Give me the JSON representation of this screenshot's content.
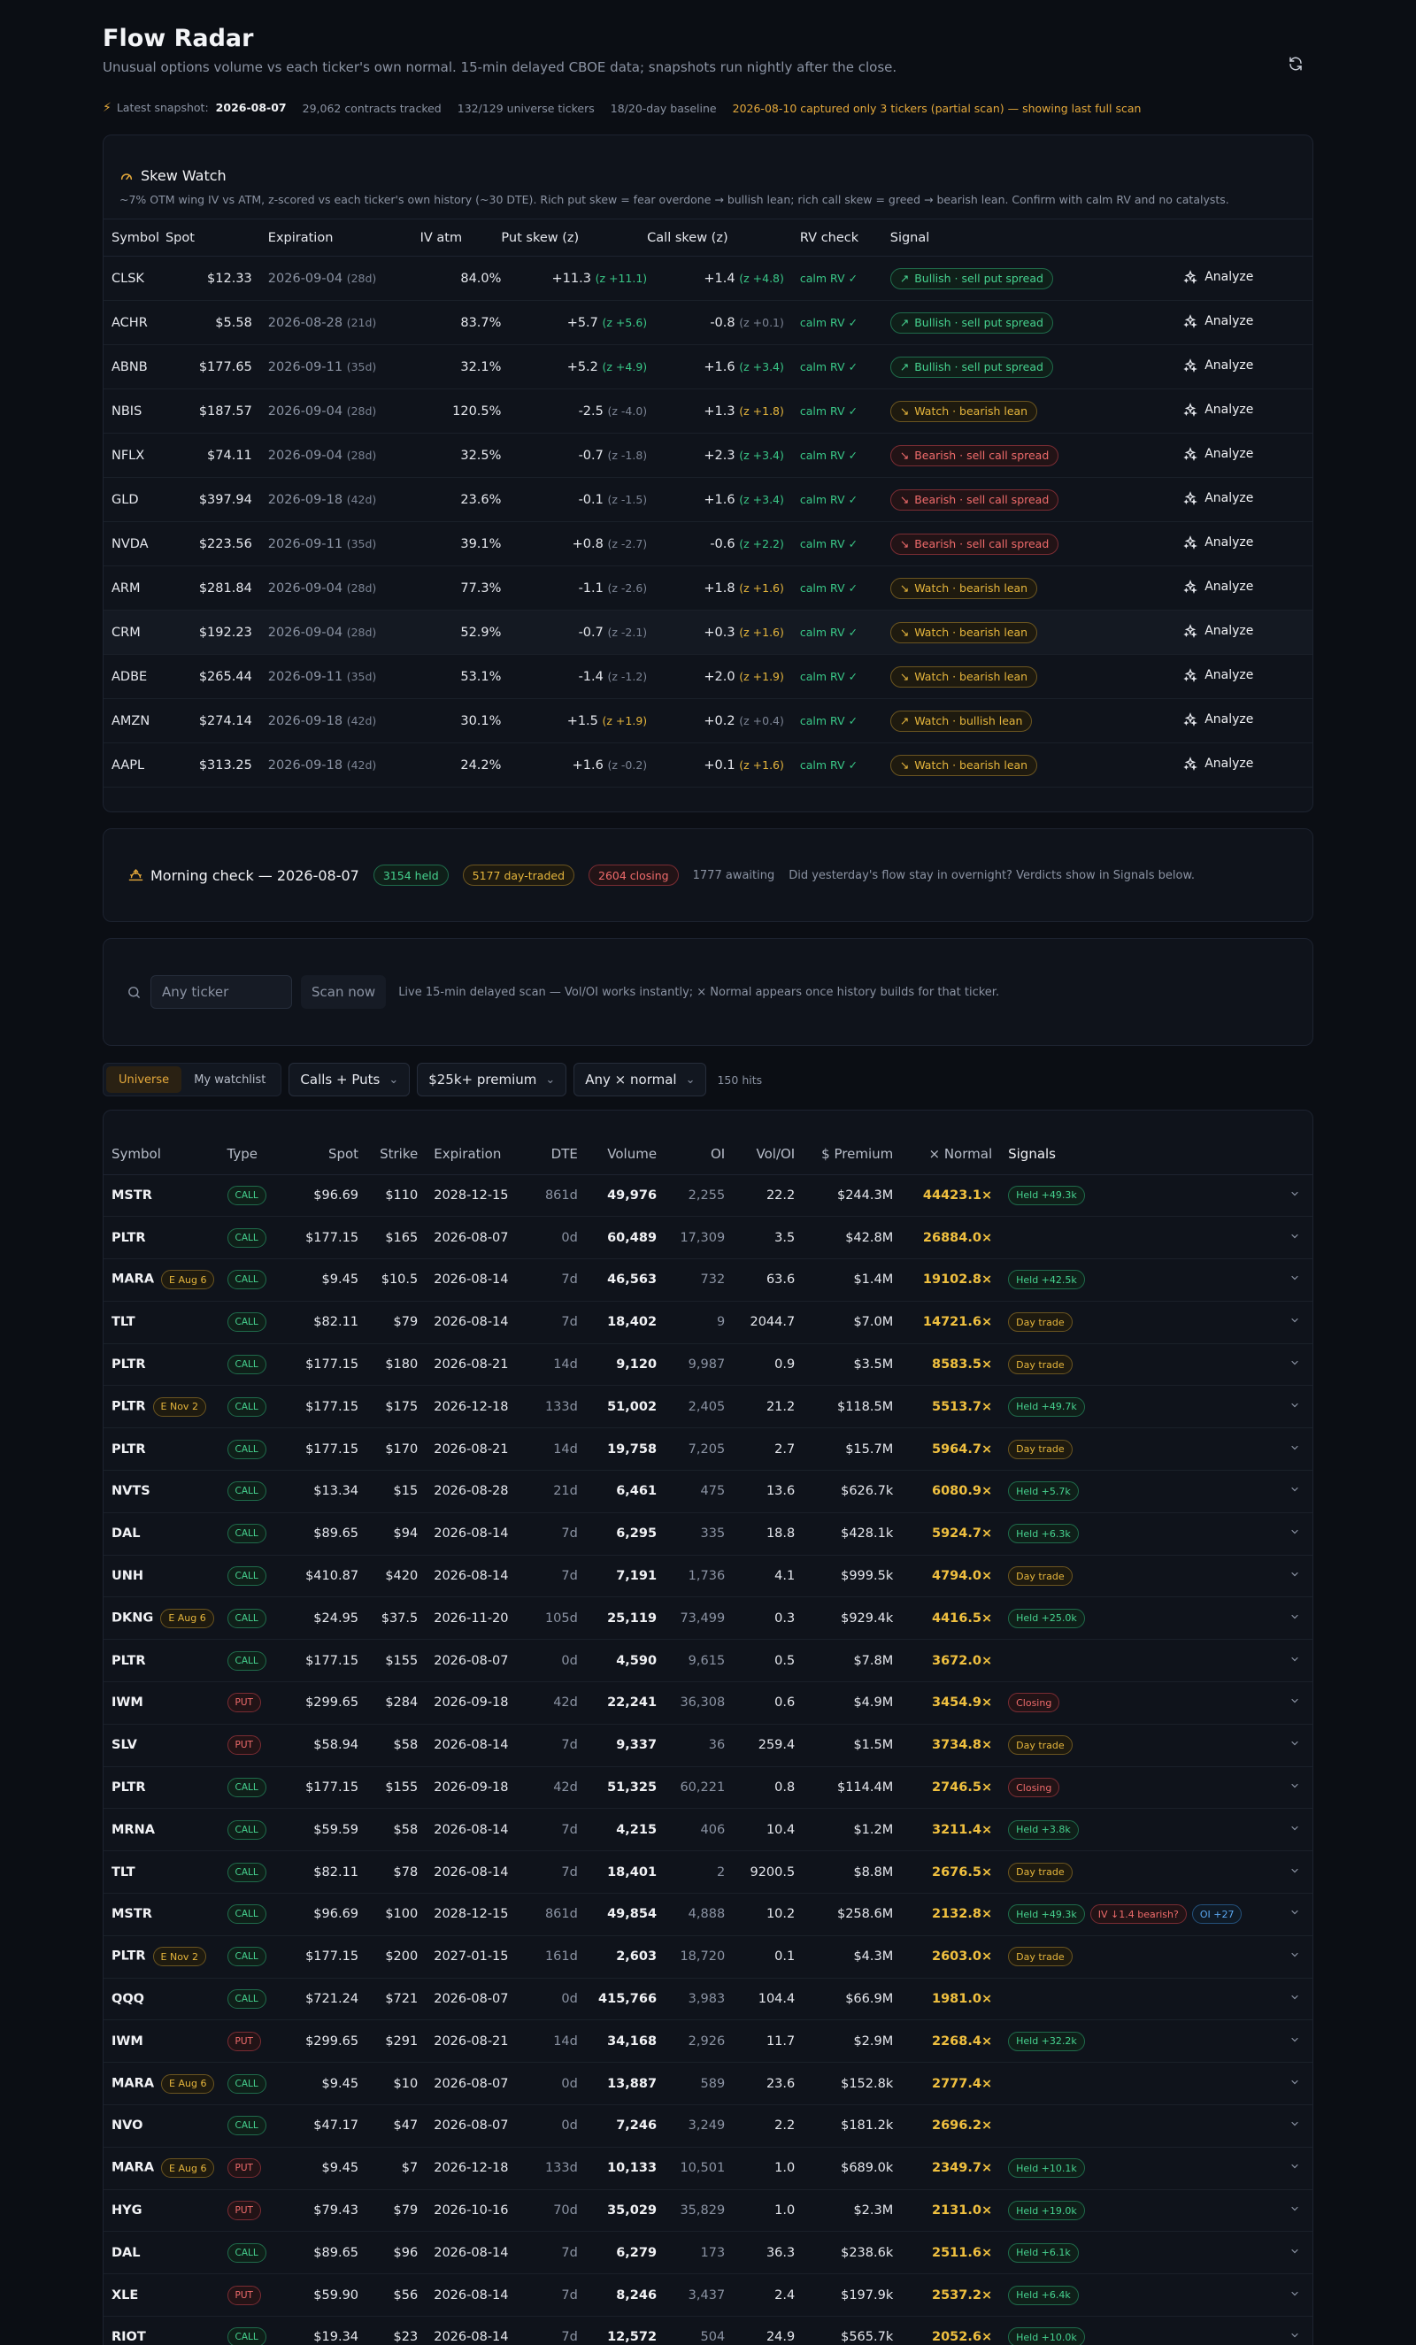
{
  "header": {
    "title": "Flow Radar",
    "subtitle": "Unusual options volume vs each ticker's own normal. 15-min delayed CBOE data; snapshots run nightly after the close."
  },
  "meta": {
    "latest_label": "Latest snapshot:",
    "latest_date": "2026-08-07",
    "contracts": "29,062 contracts tracked",
    "universe": "132/129 universe tickers",
    "baseline": "18/20-day baseline",
    "warning": "2026-08-10 captured only 3 tickers (partial scan) — showing last full scan"
  },
  "skew": {
    "title": "Skew Watch",
    "description": "~7% OTM wing IV vs ATM, z-scored vs each ticker's own history (~30 DTE). Rich put skew = fear overdone → bullish lean; rich call skew = greed → bearish lean. Confirm with calm RV and no catalysts.",
    "columns": [
      "Symbol",
      "Spot",
      "Expiration",
      "IV atm",
      "Put skew (z)",
      "Call skew (z)",
      "RV check",
      "Signal"
    ],
    "analyze_label": "Analyze",
    "rows": [
      {
        "symbol": "CLSK",
        "spot": "$12.33",
        "exp": "2026-09-04",
        "dte": "(28d)",
        "iv": "84.0%",
        "put": "+11.3",
        "put_z": "(z +11.1)",
        "put_c": "g",
        "call": "+1.4",
        "call_z": "(z +4.8)",
        "call_c": "g",
        "rv": "calm RV ✓",
        "signal": "Bullish · sell put spread",
        "sig_c": "g",
        "sig_icon": "↗"
      },
      {
        "symbol": "ACHR",
        "spot": "$5.58",
        "exp": "2026-08-28",
        "dte": "(21d)",
        "iv": "83.7%",
        "put": "+5.7",
        "put_z": "(z +5.6)",
        "put_c": "g",
        "call": "-0.8",
        "call_z": "(z +0.1)",
        "call_c": "n",
        "rv": "calm RV ✓",
        "signal": "Bullish · sell put spread",
        "sig_c": "g",
        "sig_icon": "↗"
      },
      {
        "symbol": "ABNB",
        "spot": "$177.65",
        "exp": "2026-09-11",
        "dte": "(35d)",
        "iv": "32.1%",
        "put": "+5.2",
        "put_z": "(z +4.9)",
        "put_c": "g",
        "call": "+1.6",
        "call_z": "(z +3.4)",
        "call_c": "g",
        "rv": "calm RV ✓",
        "signal": "Bullish · sell put spread",
        "sig_c": "g",
        "sig_icon": "↗"
      },
      {
        "symbol": "NBIS",
        "spot": "$187.57",
        "exp": "2026-09-04",
        "dte": "(28d)",
        "iv": "120.5%",
        "put": "-2.5",
        "put_z": "(z -4.0)",
        "put_c": "n",
        "call": "+1.3",
        "call_z": "(z +1.8)",
        "call_c": "y",
        "rv": "calm RV ✓",
        "signal": "Watch · bearish lean",
        "sig_c": "y",
        "sig_icon": "↘"
      },
      {
        "symbol": "NFLX",
        "spot": "$74.11",
        "exp": "2026-09-04",
        "dte": "(28d)",
        "iv": "32.5%",
        "put": "-0.7",
        "put_z": "(z -1.8)",
        "put_c": "n",
        "call": "+2.3",
        "call_z": "(z +3.4)",
        "call_c": "g",
        "rv": "calm RV ✓",
        "signal": "Bearish · sell call spread",
        "sig_c": "r",
        "sig_icon": "↘"
      },
      {
        "symbol": "GLD",
        "spot": "$397.94",
        "exp": "2026-09-18",
        "dte": "(42d)",
        "iv": "23.6%",
        "put": "-0.1",
        "put_z": "(z -1.5)",
        "put_c": "n",
        "call": "+1.6",
        "call_z": "(z +3.4)",
        "call_c": "g",
        "rv": "calm RV ✓",
        "signal": "Bearish · sell call spread",
        "sig_c": "r",
        "sig_icon": "↘"
      },
      {
        "symbol": "NVDA",
        "spot": "$223.56",
        "exp": "2026-09-11",
        "dte": "(35d)",
        "iv": "39.1%",
        "put": "+0.8",
        "put_z": "(z -2.7)",
        "put_c": "n",
        "call": "-0.6",
        "call_z": "(z +2.2)",
        "call_c": "g",
        "rv": "calm RV ✓",
        "signal": "Bearish · sell call spread",
        "sig_c": "r",
        "sig_icon": "↘"
      },
      {
        "symbol": "ARM",
        "spot": "$281.84",
        "exp": "2026-09-04",
        "dte": "(28d)",
        "iv": "77.3%",
        "put": "-1.1",
        "put_z": "(z -2.6)",
        "put_c": "n",
        "call": "+1.8",
        "call_z": "(z +1.6)",
        "call_c": "y",
        "rv": "calm RV ✓",
        "signal": "Watch · bearish lean",
        "sig_c": "y",
        "sig_icon": "↘"
      },
      {
        "symbol": "CRM",
        "spot": "$192.23",
        "exp": "2026-09-04",
        "dte": "(28d)",
        "iv": "52.9%",
        "put": "-0.7",
        "put_z": "(z -2.1)",
        "put_c": "n",
        "call": "+0.3",
        "call_z": "(z +1.6)",
        "call_c": "y",
        "rv": "calm RV ✓",
        "signal": "Watch · bearish lean",
        "sig_c": "y",
        "sig_icon": "↘"
      },
      {
        "symbol": "ADBE",
        "spot": "$265.44",
        "exp": "2026-09-11",
        "dte": "(35d)",
        "iv": "53.1%",
        "put": "-1.4",
        "put_z": "(z -1.2)",
        "put_c": "n",
        "call": "+2.0",
        "call_z": "(z +1.9)",
        "call_c": "y",
        "rv": "calm RV ✓",
        "signal": "Watch · bearish lean",
        "sig_c": "y",
        "sig_icon": "↘"
      },
      {
        "symbol": "AMZN",
        "spot": "$274.14",
        "exp": "2026-09-18",
        "dte": "(42d)",
        "iv": "30.1%",
        "put": "+1.5",
        "put_z": "(z +1.9)",
        "put_c": "y",
        "call": "+0.2",
        "call_z": "(z +0.4)",
        "call_c": "n",
        "rv": "calm RV ✓",
        "signal": "Watch · bullish lean",
        "sig_c": "y",
        "sig_icon": "↗"
      },
      {
        "symbol": "AAPL",
        "spot": "$313.25",
        "exp": "2026-09-18",
        "dte": "(42d)",
        "iv": "24.2%",
        "put": "+1.6",
        "put_z": "(z -0.2)",
        "put_c": "n",
        "call": "+0.1",
        "call_z": "(z +1.6)",
        "call_c": "y",
        "rv": "calm RV ✓",
        "signal": "Watch · bearish lean",
        "sig_c": "y",
        "sig_icon": "↘"
      }
    ]
  },
  "morning": {
    "title": "Morning check — 2026-08-07",
    "held": "3154 held",
    "day_traded": "5177 day-traded",
    "closing": "2604 closing",
    "awaiting": "1777 awaiting",
    "note": "Did yesterday's flow stay in overnight? Verdicts show in Signals below."
  },
  "scan": {
    "placeholder": "Any ticker",
    "button": "Scan now",
    "note": "Live 15-min delayed scan — Vol/OI works instantly; × Normal appears once history builds for that ticker."
  },
  "filters": {
    "universe": "Universe",
    "watchlist": "My watchlist",
    "type": "Calls + Puts",
    "premium": "$25k+ premium",
    "normal": "Any × normal",
    "hits": "150 hits"
  },
  "flow": {
    "columns": [
      "Symbol",
      "Type",
      "Spot",
      "Strike",
      "Expiration",
      "DTE",
      "Volume",
      "OI",
      "Vol/OI",
      "$ Premium",
      "× Normal",
      "Signals"
    ],
    "rows": [
      {
        "sym": "MSTR",
        "earn": "",
        "type": "CALL",
        "spot": "$96.69",
        "strike": "$110",
        "exp": "2028-12-15",
        "dte": "861d",
        "vol": "49,976",
        "oi": "2,255",
        "voi": "22.2",
        "prem": "$244.3M",
        "xn": "44423.1×",
        "sigs": [
          {
            "t": "Held +49.3k",
            "c": "held"
          }
        ]
      },
      {
        "sym": "PLTR",
        "earn": "",
        "type": "CALL",
        "spot": "$177.15",
        "strike": "$165",
        "exp": "2026-08-07",
        "dte": "0d",
        "vol": "60,489",
        "oi": "17,309",
        "voi": "3.5",
        "prem": "$42.8M",
        "xn": "26884.0×",
        "sigs": []
      },
      {
        "sym": "MARA",
        "earn": "E Aug 6",
        "type": "CALL",
        "spot": "$9.45",
        "strike": "$10.5",
        "exp": "2026-08-14",
        "dte": "7d",
        "vol": "46,563",
        "oi": "732",
        "voi": "63.6",
        "prem": "$1.4M",
        "xn": "19102.8×",
        "sigs": [
          {
            "t": "Held +42.5k",
            "c": "held"
          }
        ]
      },
      {
        "sym": "TLT",
        "earn": "",
        "type": "CALL",
        "spot": "$82.11",
        "strike": "$79",
        "exp": "2026-08-14",
        "dte": "7d",
        "vol": "18,402",
        "oi": "9",
        "voi": "2044.7",
        "prem": "$7.0M",
        "xn": "14721.6×",
        "sigs": [
          {
            "t": "Day trade",
            "c": "day"
          }
        ]
      },
      {
        "sym": "PLTR",
        "earn": "",
        "type": "CALL",
        "spot": "$177.15",
        "strike": "$180",
        "exp": "2026-08-21",
        "dte": "14d",
        "vol": "9,120",
        "oi": "9,987",
        "voi": "0.9",
        "prem": "$3.5M",
        "xn": "8583.5×",
        "sigs": [
          {
            "t": "Day trade",
            "c": "day"
          }
        ]
      },
      {
        "sym": "PLTR",
        "earn": "E Nov 2",
        "type": "CALL",
        "spot": "$177.15",
        "strike": "$175",
        "exp": "2026-12-18",
        "dte": "133d",
        "vol": "51,002",
        "oi": "2,405",
        "voi": "21.2",
        "prem": "$118.5M",
        "xn": "5513.7×",
        "sigs": [
          {
            "t": "Held +49.7k",
            "c": "held"
          }
        ]
      },
      {
        "sym": "PLTR",
        "earn": "",
        "type": "CALL",
        "spot": "$177.15",
        "strike": "$170",
        "exp": "2026-08-21",
        "dte": "14d",
        "vol": "19,758",
        "oi": "7,205",
        "voi": "2.7",
        "prem": "$15.7M",
        "xn": "5964.7×",
        "sigs": [
          {
            "t": "Day trade",
            "c": "day"
          }
        ]
      },
      {
        "sym": "NVTS",
        "earn": "",
        "type": "CALL",
        "spot": "$13.34",
        "strike": "$15",
        "exp": "2026-08-28",
        "dte": "21d",
        "vol": "6,461",
        "oi": "475",
        "voi": "13.6",
        "prem": "$626.7k",
        "xn": "6080.9×",
        "sigs": [
          {
            "t": "Held +5.7k",
            "c": "held"
          }
        ]
      },
      {
        "sym": "DAL",
        "earn": "",
        "type": "CALL",
        "spot": "$89.65",
        "strike": "$94",
        "exp": "2026-08-14",
        "dte": "7d",
        "vol": "6,295",
        "oi": "335",
        "voi": "18.8",
        "prem": "$428.1k",
        "xn": "5924.7×",
        "sigs": [
          {
            "t": "Held +6.3k",
            "c": "held"
          }
        ]
      },
      {
        "sym": "UNH",
        "earn": "",
        "type": "CALL",
        "spot": "$410.87",
        "strike": "$420",
        "exp": "2026-08-14",
        "dte": "7d",
        "vol": "7,191",
        "oi": "1,736",
        "voi": "4.1",
        "prem": "$999.5k",
        "xn": "4794.0×",
        "sigs": [
          {
            "t": "Day trade",
            "c": "day"
          }
        ]
      },
      {
        "sym": "DKNG",
        "earn": "E Aug 6",
        "type": "CALL",
        "spot": "$24.95",
        "strike": "$37.5",
        "exp": "2026-11-20",
        "dte": "105d",
        "vol": "25,119",
        "oi": "73,499",
        "voi": "0.3",
        "prem": "$929.4k",
        "xn": "4416.5×",
        "sigs": [
          {
            "t": "Held +25.0k",
            "c": "held"
          }
        ]
      },
      {
        "sym": "PLTR",
        "earn": "",
        "type": "CALL",
        "spot": "$177.15",
        "strike": "$155",
        "exp": "2026-08-07",
        "dte": "0d",
        "vol": "4,590",
        "oi": "9,615",
        "voi": "0.5",
        "prem": "$7.8M",
        "xn": "3672.0×",
        "sigs": []
      },
      {
        "sym": "IWM",
        "earn": "",
        "type": "PUT",
        "spot": "$299.65",
        "strike": "$284",
        "exp": "2026-09-18",
        "dte": "42d",
        "vol": "22,241",
        "oi": "36,308",
        "voi": "0.6",
        "prem": "$4.9M",
        "xn": "3454.9×",
        "sigs": [
          {
            "t": "Closing",
            "c": "close"
          }
        ]
      },
      {
        "sym": "SLV",
        "earn": "",
        "type": "PUT",
        "spot": "$58.94",
        "strike": "$58",
        "exp": "2026-08-14",
        "dte": "7d",
        "vol": "9,337",
        "oi": "36",
        "voi": "259.4",
        "prem": "$1.5M",
        "xn": "3734.8×",
        "sigs": [
          {
            "t": "Day trade",
            "c": "day"
          }
        ]
      },
      {
        "sym": "PLTR",
        "earn": "",
        "type": "CALL",
        "spot": "$177.15",
        "strike": "$155",
        "exp": "2026-09-18",
        "dte": "42d",
        "vol": "51,325",
        "oi": "60,221",
        "voi": "0.8",
        "prem": "$114.4M",
        "xn": "2746.5×",
        "sigs": [
          {
            "t": "Closing",
            "c": "close"
          }
        ]
      },
      {
        "sym": "MRNA",
        "earn": "",
        "type": "CALL",
        "spot": "$59.59",
        "strike": "$58",
        "exp": "2026-08-14",
        "dte": "7d",
        "vol": "4,215",
        "oi": "406",
        "voi": "10.4",
        "prem": "$1.2M",
        "xn": "3211.4×",
        "sigs": [
          {
            "t": "Held +3.8k",
            "c": "held"
          }
        ]
      },
      {
        "sym": "TLT",
        "earn": "",
        "type": "CALL",
        "spot": "$82.11",
        "strike": "$78",
        "exp": "2026-08-14",
        "dte": "7d",
        "vol": "18,401",
        "oi": "2",
        "voi": "9200.5",
        "prem": "$8.8M",
        "xn": "2676.5×",
        "sigs": [
          {
            "t": "Day trade",
            "c": "day"
          }
        ]
      },
      {
        "sym": "MSTR",
        "earn": "",
        "type": "CALL",
        "spot": "$96.69",
        "strike": "$100",
        "exp": "2028-12-15",
        "dte": "861d",
        "vol": "49,854",
        "oi": "4,888",
        "voi": "10.2",
        "prem": "$258.6M",
        "xn": "2132.8×",
        "sigs": [
          {
            "t": "Held +49.3k",
            "c": "held"
          },
          {
            "t": "IV ↓1.4 bearish?",
            "c": "iv"
          },
          {
            "t": "OI +27",
            "c": "oi"
          }
        ]
      },
      {
        "sym": "PLTR",
        "earn": "E Nov 2",
        "type": "CALL",
        "spot": "$177.15",
        "strike": "$200",
        "exp": "2027-01-15",
        "dte": "161d",
        "vol": "2,603",
        "oi": "18,720",
        "voi": "0.1",
        "prem": "$4.3M",
        "xn": "2603.0×",
        "sigs": [
          {
            "t": "Day trade",
            "c": "day"
          }
        ]
      },
      {
        "sym": "QQQ",
        "earn": "",
        "type": "CALL",
        "spot": "$721.24",
        "strike": "$721",
        "exp": "2026-08-07",
        "dte": "0d",
        "vol": "415,766",
        "oi": "3,983",
        "voi": "104.4",
        "prem": "$66.9M",
        "xn": "1981.0×",
        "sigs": []
      },
      {
        "sym": "IWM",
        "earn": "",
        "type": "PUT",
        "spot": "$299.65",
        "strike": "$291",
        "exp": "2026-08-21",
        "dte": "14d",
        "vol": "34,168",
        "oi": "2,926",
        "voi": "11.7",
        "prem": "$2.9M",
        "xn": "2268.4×",
        "sigs": [
          {
            "t": "Held +32.2k",
            "c": "held"
          }
        ]
      },
      {
        "sym": "MARA",
        "earn": "E Aug 6",
        "type": "CALL",
        "spot": "$9.45",
        "strike": "$10",
        "exp": "2026-08-07",
        "dte": "0d",
        "vol": "13,887",
        "oi": "589",
        "voi": "23.6",
        "prem": "$152.8k",
        "xn": "2777.4×",
        "sigs": []
      },
      {
        "sym": "NVO",
        "earn": "",
        "type": "CALL",
        "spot": "$47.17",
        "strike": "$47",
        "exp": "2026-08-07",
        "dte": "0d",
        "vol": "7,246",
        "oi": "3,249",
        "voi": "2.2",
        "prem": "$181.2k",
        "xn": "2696.2×",
        "sigs": []
      },
      {
        "sym": "MARA",
        "earn": "E Aug 6",
        "type": "PUT",
        "spot": "$9.45",
        "strike": "$7",
        "exp": "2026-12-18",
        "dte": "133d",
        "vol": "10,133",
        "oi": "10,501",
        "voi": "1.0",
        "prem": "$689.0k",
        "xn": "2349.7×",
        "sigs": [
          {
            "t": "Held +10.1k",
            "c": "held"
          }
        ]
      },
      {
        "sym": "HYG",
        "earn": "",
        "type": "PUT",
        "spot": "$79.43",
        "strike": "$79",
        "exp": "2026-10-16",
        "dte": "70d",
        "vol": "35,029",
        "oi": "35,829",
        "voi": "1.0",
        "prem": "$2.3M",
        "xn": "2131.0×",
        "sigs": [
          {
            "t": "Held +19.0k",
            "c": "held"
          }
        ]
      },
      {
        "sym": "DAL",
        "earn": "",
        "type": "CALL",
        "spot": "$89.65",
        "strike": "$96",
        "exp": "2026-08-14",
        "dte": "7d",
        "vol": "6,279",
        "oi": "173",
        "voi": "36.3",
        "prem": "$238.6k",
        "xn": "2511.6×",
        "sigs": [
          {
            "t": "Held +6.1k",
            "c": "held"
          }
        ]
      },
      {
        "sym": "XLE",
        "earn": "",
        "type": "PUT",
        "spot": "$59.90",
        "strike": "$56",
        "exp": "2026-08-14",
        "dte": "7d",
        "vol": "8,246",
        "oi": "3,437",
        "voi": "2.4",
        "prem": "$197.9k",
        "xn": "2537.2×",
        "sigs": [
          {
            "t": "Held +6.4k",
            "c": "held"
          }
        ]
      },
      {
        "sym": "RIOT",
        "earn": "",
        "type": "CALL",
        "spot": "$19.34",
        "strike": "$23",
        "exp": "2026-08-14",
        "dte": "7d",
        "vol": "12,572",
        "oi": "504",
        "voi": "24.9",
        "prem": "$565.7k",
        "xn": "2052.6×",
        "sigs": [
          {
            "t": "Held +10.0k",
            "c": "held"
          }
        ]
      }
    ]
  }
}
